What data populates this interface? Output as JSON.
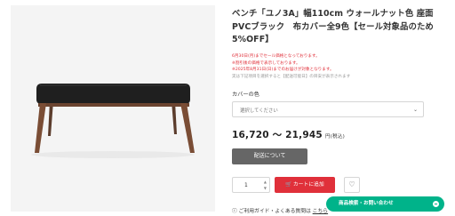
{
  "product": {
    "title": "ベンチ「ユノ3A」幅110cm ウォールナット色 座面PVCブラック　布カバー全9色【セール対象品のため5%OFF】",
    "notices": [
      {
        "text": "6月30日(月)までセール価格となっております。",
        "color": "red"
      },
      {
        "text": "※割引後の価格で表示しております。",
        "color": "red"
      },
      {
        "text": "※2025年8月31日(日)までのお届けが対象となります。",
        "color": "red"
      },
      {
        "text": "実は下記項目を選択すると【配送可能日】の目安が表示されます",
        "color": "grey"
      }
    ],
    "cover_label": "カバーの色",
    "cover_select_placeholder": "選択してください",
    "price": "16,720 〜 21,945",
    "price_tax": "円(税込)",
    "shipping_button": "配送について",
    "quantity": "1",
    "add_to_cart": "カートに追加",
    "guide_text": "ご利用ガイド・よくある質問は",
    "guide_link": "こちら"
  },
  "contact_button": "商品検索・お問い合わせ",
  "colors": {
    "accent_red": "#e0303a",
    "contact_green": "#00b38a",
    "shipping_grey": "#666666"
  },
  "icons": {
    "cart": "cart-icon",
    "favorite": "heart-icon",
    "select_chevron": "chevron-down-icon",
    "guide": "question-circle-icon",
    "chat": "chat-bubble-icon"
  }
}
